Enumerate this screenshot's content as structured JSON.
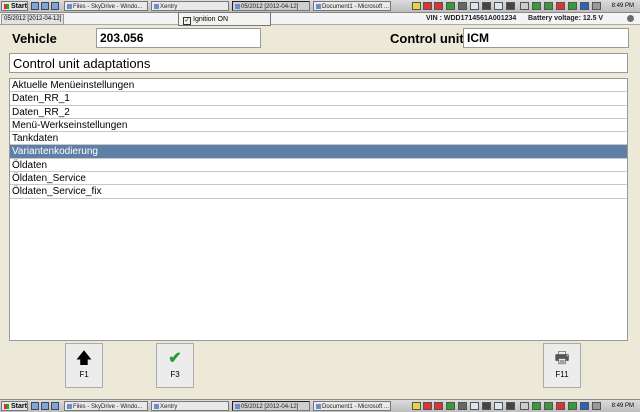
{
  "taskbar": {
    "start_label": "Start",
    "tasks": [
      "Files - SkyDrive - Windo...",
      "Xentry",
      "05/2012 [2012-04-12]",
      "Document1 - Microsoft ..."
    ],
    "clock": "8:49 PM"
  },
  "window": {
    "label": "05/2012 [2012-04-12]"
  },
  "tooltip": {
    "text": "Ignition ON"
  },
  "status": {
    "vin": "VIN : WDD1714561A001234",
    "battery": "Battery voltage: 12.5 V"
  },
  "vehicle": {
    "label": "Vehicle",
    "value": "203.056"
  },
  "control_unit": {
    "label": "Control unit",
    "value": "ICM"
  },
  "section_title": "Control unit adaptations",
  "list": {
    "selected_index": 5,
    "items": [
      "Aktuelle Menüeinstellungen",
      "Daten_RR_1",
      "Daten_RR_2",
      "Menü-Werkseinstellungen",
      "Tankdaten",
      "Variantenkodierung",
      "Öldaten",
      "Öldaten_Service",
      "Öldaten_Service_fix"
    ]
  },
  "buttons": {
    "f1": "F1",
    "f3": "F3",
    "f11": "F11"
  },
  "colors": {
    "selection": "#5f7fa6",
    "check": "#2e9a2e"
  }
}
